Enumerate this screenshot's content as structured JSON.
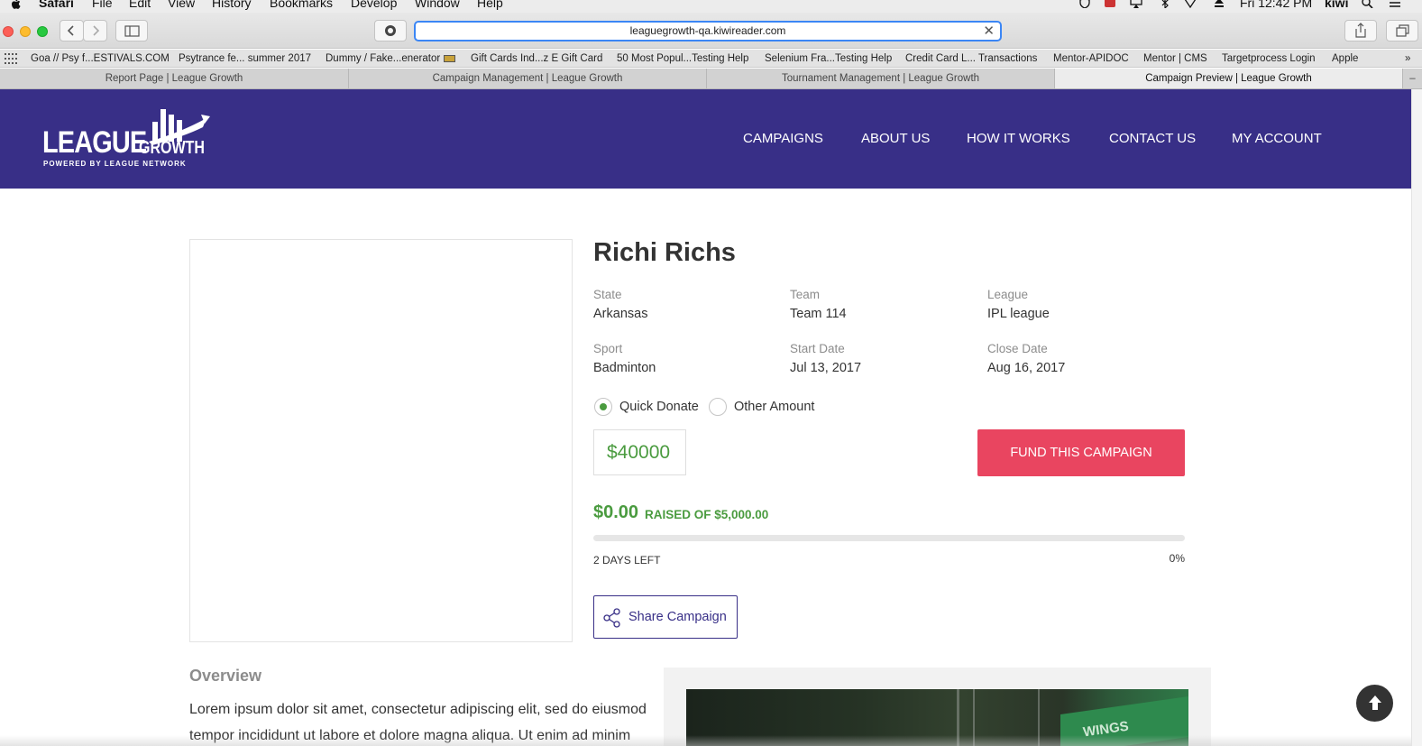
{
  "menubar": {
    "app_name": "Safari",
    "items": [
      "File",
      "Edit",
      "View",
      "History",
      "Bookmarks",
      "Develop",
      "Window",
      "Help"
    ],
    "clock": "Fri 12:42 PM",
    "user": "kiwi"
  },
  "browser": {
    "url": "leaguegrowth-qa.kiwireader.com",
    "bookmarks": [
      "Goa // Psy f...ESTIVALS.COM",
      "Psytrance fe... summer 2017",
      "Dummy / Fake...enerator",
      "Gift Cards Ind...z E Gift Card",
      "50 Most Popul...Testing Help",
      "Selenium Fra...Testing Help",
      "Credit Card L... Transactions",
      "Mentor-APIDOC",
      "Mentor | CMS",
      "Targetprocess Login",
      "Apple"
    ],
    "tabs": [
      "Report Page | League Growth",
      "Campaign Management | League Growth",
      "Tournament Management | League Growth",
      "Campaign Preview | League Growth"
    ],
    "active_tab_index": 3
  },
  "site": {
    "logo": {
      "word1": "LEAGUE",
      "word2": "GROWTH",
      "tagline": "POWERED BY LEAGUE NETWORK"
    },
    "nav": [
      "CAMPAIGNS",
      "ABOUT US",
      "HOW IT WORKS",
      "CONTACT US",
      "MY ACCOUNT"
    ]
  },
  "campaign": {
    "title": "Richi Richs",
    "details": [
      {
        "label": "State",
        "value": "Arkansas"
      },
      {
        "label": "Team",
        "value": "Team 114"
      },
      {
        "label": "League",
        "value": "IPL league"
      },
      {
        "label": "Sport",
        "value": "Badminton"
      },
      {
        "label": "Start Date",
        "value": "Jul 13, 2017"
      },
      {
        "label": "Close Date",
        "value": "Aug 16, 2017"
      }
    ],
    "donate_options": [
      {
        "label": "Quick Donate",
        "checked": true
      },
      {
        "label": "Other Amount",
        "checked": false
      }
    ],
    "amount": "$40000",
    "fund_button": "FUND THIS CAMPAIGN",
    "raised": "$0.00",
    "raised_of": "RAISED OF $5,000.00",
    "progress_fraction": 0,
    "days_left": "2 DAYS LEFT",
    "percent_label": "0%",
    "share_button": "Share Campaign"
  },
  "overview": {
    "title": "Overview",
    "text": "Lorem ipsum dolor sit amet, consectetur adipiscing elit, sed do eiusmod tempor incididunt ut labore et dolore magna aliqua. Ut enim ad minim"
  },
  "video": {
    "banner_text": "WINGS"
  },
  "colors": {
    "header_bg": "#382f87",
    "accent_green": "#4a9b3f",
    "fund_red": "#e94560",
    "address_focus": "#3b86f5"
  }
}
